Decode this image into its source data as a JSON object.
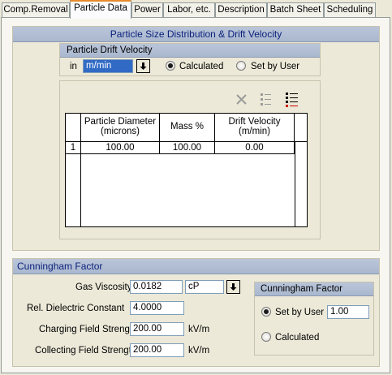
{
  "tabs": [
    {
      "label": "Comp.Removal",
      "active": false
    },
    {
      "label": "Particle Data",
      "active": true
    },
    {
      "label": "Power",
      "active": false
    },
    {
      "label": "Labor, etc.",
      "active": false
    },
    {
      "label": "Description",
      "active": false
    },
    {
      "label": "Batch Sheet",
      "active": false
    },
    {
      "label": "Scheduling",
      "active": false
    }
  ],
  "psd": {
    "title": "Particle Size Distribution & Drift Velocity",
    "drift": {
      "title": "Particle Drift Velocity",
      "in_label": "in",
      "unit": "m/min",
      "calculated_label": "Calculated",
      "set_by_user_label": "Set by User",
      "selected": "Calculated"
    },
    "toolbar": {
      "delete_icon": "delete-x-icon",
      "list_icon": "list-icon",
      "list_add_icon": "list-add-icon"
    },
    "table": {
      "headers": [
        "Particle Diameter\n(microns)",
        "Mass %",
        "Drift Velocity\n(m/min)"
      ],
      "rows": [
        {
          "index": "1",
          "cells": [
            "100.00",
            "100.00",
            "0.00"
          ]
        }
      ]
    }
  },
  "cunningham": {
    "title": "Cunningham Factor",
    "gas_viscosity_label": "Gas Viscosity",
    "gas_viscosity_value": "0.0182",
    "gas_viscosity_unit": "cP",
    "dielectric_label": "Rel. Dielectric Constant",
    "dielectric_value": "4.0000",
    "charging_label": "Charging Field Strength",
    "charging_value": "200.00",
    "charging_unit": "kV/m",
    "collecting_label": "Collecting Field Strength",
    "collecting_value": "200.00",
    "collecting_unit": "kV/m",
    "factor_box": {
      "title": "Cunningham Factor",
      "set_by_user_label": "Set by User",
      "set_by_user_value": "1.00",
      "calculated_label": "Calculated",
      "selected": "Set by User"
    }
  }
}
